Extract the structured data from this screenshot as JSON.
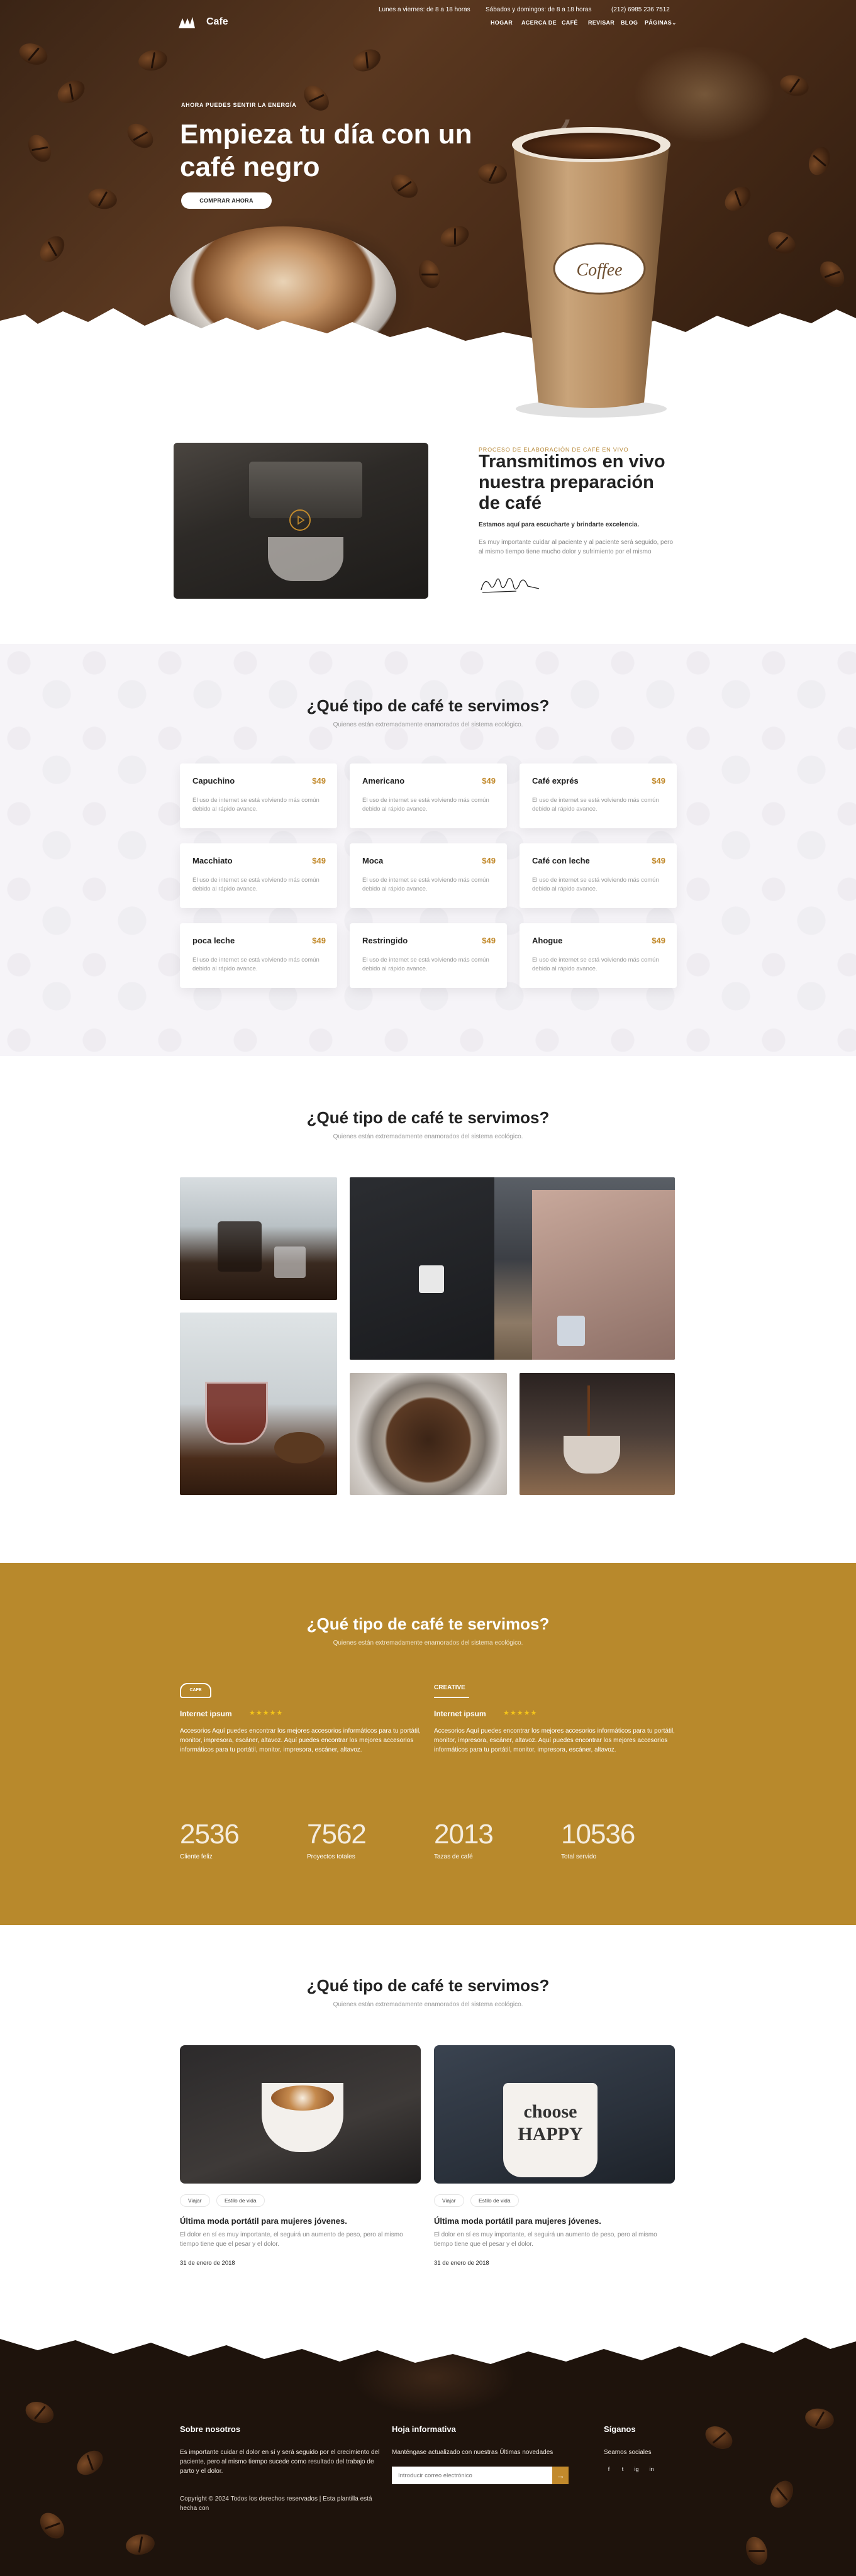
{
  "brand": {
    "name": "Cafe"
  },
  "header": {
    "hours_weekdays": "Lunes a viernes: de 8 a 18 horas",
    "hours_weekend": "Sábados y domingos: de 8 a 18 horas",
    "phone": "(212) 6985 236 7512",
    "nav": [
      "HOGAR",
      "ACERCA DE",
      "CAFÉ",
      "REVISAR",
      "BLOG",
      "PÁGINAS"
    ]
  },
  "hero": {
    "kicker": "AHORA PUEDES SENTIR LA ENERGÍA",
    "title": "Empieza tu día con un café negro",
    "button": "COMPRAR AHORA",
    "cup_label": "Coffee"
  },
  "about": {
    "kicker": "PROCESO DE ELABORACIÓN DE CAFÉ EN VIVO",
    "title": "Transmitimos en vivo nuestra preparación de café",
    "subtitle": "Estamos aquí para escucharte y brindarte excelencia.",
    "text": "Es muy importante cuidar al paciente y al paciente será seguido, pero al mismo tiempo tiene mucho dolor y sufrimiento por el mismo"
  },
  "menu": {
    "title": "¿Qué tipo de café te servimos?",
    "subtitle": "Quienes están extremadamente enamorados del sistema ecológico.",
    "items": [
      {
        "name": "Capuchino",
        "price": "$49",
        "desc": "El uso de internet se está volviendo más común debido al rápido avance."
      },
      {
        "name": "Americano",
        "price": "$49",
        "desc": "El uso de internet se está volviendo más común debido al rápido avance."
      },
      {
        "name": "Café exprés",
        "price": "$49",
        "desc": "El uso de internet se está volviendo más común debido al rápido avance."
      },
      {
        "name": "Macchiato",
        "price": "$49",
        "desc": "El uso de internet se está volviendo más común debido al rápido avance."
      },
      {
        "name": "Moca",
        "price": "$49",
        "desc": "El uso de internet se está volviendo más común debido al rápido avance."
      },
      {
        "name": "Café con leche",
        "price": "$49",
        "desc": "El uso de internet se está volviendo más común debido al rápido avance."
      },
      {
        "name": "poca leche",
        "price": "$49",
        "desc": "El uso de internet se está volviendo más común debido al rápido avance."
      },
      {
        "name": "Restringido",
        "price": "$49",
        "desc": "El uso de internet se está volviendo más común debido al rápido avance."
      },
      {
        "name": "Ahogue",
        "price": "$49",
        "desc": "El uso de internet se está volviendo más común debido al rápido avance."
      }
    ]
  },
  "gallery": {
    "title": "¿Qué tipo de café te servimos?",
    "subtitle": "Quienes están extremadamente enamorados del sistema ecológico."
  },
  "testimonials": {
    "title": "¿Qué tipo de café te servimos?",
    "subtitle": "Quienes están extremadamente enamorados del sistema ecológico.",
    "items": [
      {
        "logo": "CAFE",
        "name": "Internet ipsum",
        "stars": "★★★★★",
        "text": "Accesorios Aquí puedes encontrar los mejores accesorios informáticos para tu portátil, monitor, impresora, escáner, altavoz. Aquí puedes encontrar los mejores accesorios informáticos para tu portátil, monitor, impresora, escáner, altavoz."
      },
      {
        "logo": "CREATIVE",
        "name": "Internet ipsum",
        "stars": "★★★★★",
        "text": "Accesorios Aquí puedes encontrar los mejores accesorios informáticos para tu portátil, monitor, impresora, escáner, altavoz. Aquí puedes encontrar los mejores accesorios informáticos para tu portátil, monitor, impresora, escáner, altavoz."
      }
    ],
    "stats": [
      {
        "value": "2536",
        "label": "Cliente feliz"
      },
      {
        "value": "7562",
        "label": "Proyectos totales"
      },
      {
        "value": "2013",
        "label": "Tazas de café"
      },
      {
        "value": "10536",
        "label": "Total servido"
      }
    ]
  },
  "blog": {
    "title": "¿Qué tipo de café te servimos?",
    "subtitle": "Quienes están extremadamente enamorados del sistema ecológico.",
    "posts": [
      {
        "tags": [
          "Viajar",
          "Estilo de vida"
        ],
        "title": "Última moda portátil para mujeres jóvenes.",
        "excerpt": "El dolor en sí es muy importante, el seguirá un aumento de peso, pero al mismo tiempo tiene que el pesar y el dolor.",
        "date": "31 de enero de 2018",
        "cup_text": ""
      },
      {
        "tags": [
          "Viajar",
          "Estilo de vida"
        ],
        "title": "Última moda portátil para mujeres jóvenes.",
        "excerpt": "El dolor en sí es muy importante, el seguirá un aumento de peso, pero al mismo tiempo tiene que el pesar y el dolor.",
        "date": "31 de enero de 2018",
        "cup_text": "choose HAPPY"
      }
    ]
  },
  "footer": {
    "about_title": "Sobre nosotros",
    "about_text": "Es importante cuidar el dolor en sí y será seguido por el crecimiento del paciente, pero al mismo tiempo sucede como resultado del trabajo de parto y el dolor.",
    "copyright": "Copyright © 2024 Todos los derechos reservados | Esta plantilla está hecha con",
    "newsletter_title": "Hoja informativa",
    "newsletter_text": "Manténgase actualizado con nuestras Últimas novedades",
    "newsletter_placeholder": "Introducir correo electrónico",
    "follow_title": "Síganos",
    "follow_text": "Seamos sociales",
    "social": [
      "f",
      "t",
      "ig",
      "in"
    ]
  }
}
